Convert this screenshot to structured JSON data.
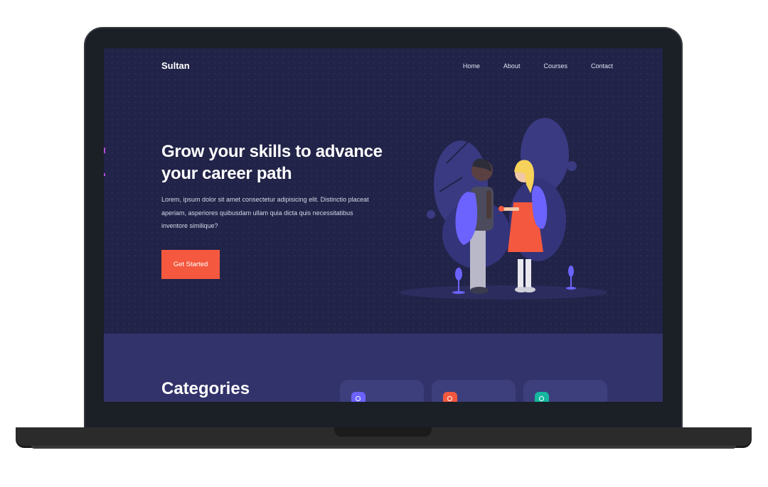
{
  "site": {
    "brand": "Sultan"
  },
  "nav": {
    "items": [
      "Home",
      "About",
      "Courses",
      "Contact"
    ]
  },
  "hero": {
    "title_line1": "Grow your skills to advance",
    "title_line2": "your career path",
    "description": "Lorem, ipsum dolor sit amet consectetur adipisicing elit. Distinctio placeat aperiam, asperiores quibusdam ullam quia dicta quis necessitatibus inventore similique?",
    "cta_label": "Get Started"
  },
  "categories": {
    "title": "Categories",
    "cards": [
      {
        "icon": "book-icon",
        "color": "#6c63ff"
      },
      {
        "icon": "book-icon",
        "color": "#f4583e"
      },
      {
        "icon": "book-icon",
        "color": "#15b79e"
      }
    ]
  },
  "colors": {
    "hero_bg": "#212348",
    "categories_bg": "#32336a",
    "accent": "#f4583e",
    "card_bg": "#3d3f7c"
  }
}
